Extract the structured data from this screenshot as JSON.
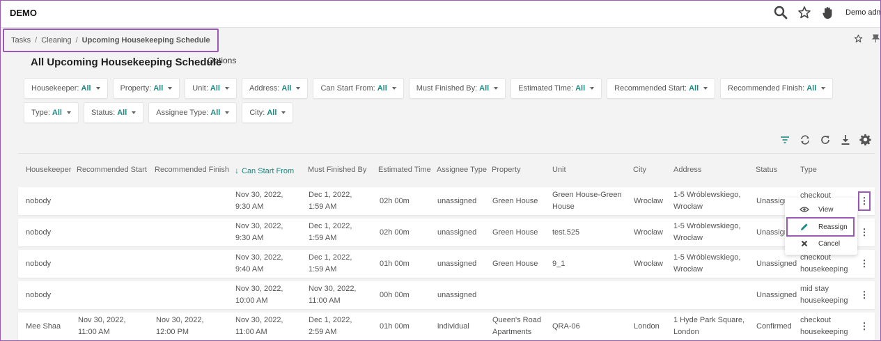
{
  "app": {
    "name": "DEMO",
    "user": "Demo admin"
  },
  "breadcrumb": {
    "items": [
      "Tasks",
      "Cleaning"
    ],
    "current": "Upcoming Housekeeping Schedule",
    "separator": "/"
  },
  "page": {
    "title": "All Upcoming Housekeeping Schedule",
    "options": "Options"
  },
  "filters": [
    {
      "label": "Housekeeper:",
      "value": "All"
    },
    {
      "label": "Property:",
      "value": "All"
    },
    {
      "label": "Unit:",
      "value": "All"
    },
    {
      "label": "Address:",
      "value": "All"
    },
    {
      "label": "Can Start From:",
      "value": "All"
    },
    {
      "label": "Must Finished By:",
      "value": "All"
    },
    {
      "label": "Estimated Time:",
      "value": "All"
    },
    {
      "label": "Recommended Start:",
      "value": "All"
    },
    {
      "label": "Recommended Finish:",
      "value": "All"
    },
    {
      "label": "Type:",
      "value": "All"
    },
    {
      "label": "Status:",
      "value": "All"
    },
    {
      "label": "Assignee Type:",
      "value": "All"
    },
    {
      "label": "City:",
      "value": "All"
    }
  ],
  "table": {
    "columns": [
      "Housekeeper",
      "Recommended Start",
      "Recommended Finish",
      "Can Start From",
      "Must Finished By",
      "Estimated Time",
      "Assignee Type",
      "Property",
      "Unit",
      "City",
      "Address",
      "Status",
      "Type"
    ],
    "rows": [
      {
        "housekeeper": "nobody",
        "rec_start": [
          "",
          ""
        ],
        "rec_finish": [
          "",
          ""
        ],
        "can_start": [
          "Nov 30, 2022,",
          "9:30 AM"
        ],
        "must_finish": [
          "Dec 1, 2022,",
          "1:59 AM"
        ],
        "est_time": "02h 00m",
        "assignee_type": "unassigned",
        "property": [
          "Green House",
          ""
        ],
        "unit": [
          "Green House-Green",
          "House"
        ],
        "city": "Wrocław",
        "address": [
          "1-5 Wróblewskiego,",
          "Wrocław"
        ],
        "status": "Unassigned",
        "type": [
          "checkout",
          ""
        ]
      },
      {
        "housekeeper": "nobody",
        "rec_start": [
          "",
          ""
        ],
        "rec_finish": [
          "",
          ""
        ],
        "can_start": [
          "Nov 30, 2022,",
          "9:30 AM"
        ],
        "must_finish": [
          "Dec 1, 2022,",
          "1:59 AM"
        ],
        "est_time": "02h 00m",
        "assignee_type": "unassigned",
        "property": [
          "Green House",
          ""
        ],
        "unit": [
          "test.525",
          ""
        ],
        "city": "Wrocław",
        "address": [
          "1-5 Wróblewskiego,",
          "Wrocław"
        ],
        "status": "Unassigned",
        "type": [
          "",
          ""
        ]
      },
      {
        "housekeeper": "nobody",
        "rec_start": [
          "",
          ""
        ],
        "rec_finish": [
          "",
          ""
        ],
        "can_start": [
          "Nov 30, 2022,",
          "9:40 AM"
        ],
        "must_finish": [
          "Dec 1, 2022,",
          "1:59 AM"
        ],
        "est_time": "01h 00m",
        "assignee_type": "unassigned",
        "property": [
          "Green House",
          ""
        ],
        "unit": [
          "9_1",
          ""
        ],
        "city": "Wrocław",
        "address": [
          "1-5 Wróblewskiego,",
          "Wrocław"
        ],
        "status": "Unassigned",
        "type": [
          "checkout",
          "housekeeping"
        ]
      },
      {
        "housekeeper": "nobody",
        "rec_start": [
          "",
          ""
        ],
        "rec_finish": [
          "",
          ""
        ],
        "can_start": [
          "Nov 30, 2022,",
          "10:00 AM"
        ],
        "must_finish": [
          "Nov 30, 2022,",
          "11:00 AM"
        ],
        "est_time": "00h 00m",
        "assignee_type": "unassigned",
        "property": [
          "",
          ""
        ],
        "unit": [
          "",
          ""
        ],
        "city": "",
        "address": [
          "",
          ""
        ],
        "status": "Unassigned",
        "type": [
          "mid stay",
          "housekeeping"
        ]
      },
      {
        "housekeeper": "Mee Shaa",
        "rec_start": [
          "Nov 30, 2022,",
          "11:00 AM"
        ],
        "rec_finish": [
          "Nov 30, 2022,",
          "12:00 PM"
        ],
        "can_start": [
          "Nov 30, 2022,",
          "11:00 AM"
        ],
        "must_finish": [
          "Dec 1, 2022,",
          "2:59 AM"
        ],
        "est_time": "01h 00m",
        "assignee_type": "individual",
        "property": [
          "Queen's Road",
          "Apartments"
        ],
        "unit": [
          "QRA-06",
          ""
        ],
        "city": "London",
        "address": [
          "1 Hyde Park Square,",
          "London"
        ],
        "status": "Confirmed",
        "type": [
          "checkout",
          "housekeeping"
        ]
      }
    ]
  },
  "row_menu": {
    "view": "View",
    "reassign": "Reassign",
    "cancel": "Cancel"
  },
  "colors": {
    "accent": "#1a8a7f",
    "highlight": "#9b59b6"
  }
}
